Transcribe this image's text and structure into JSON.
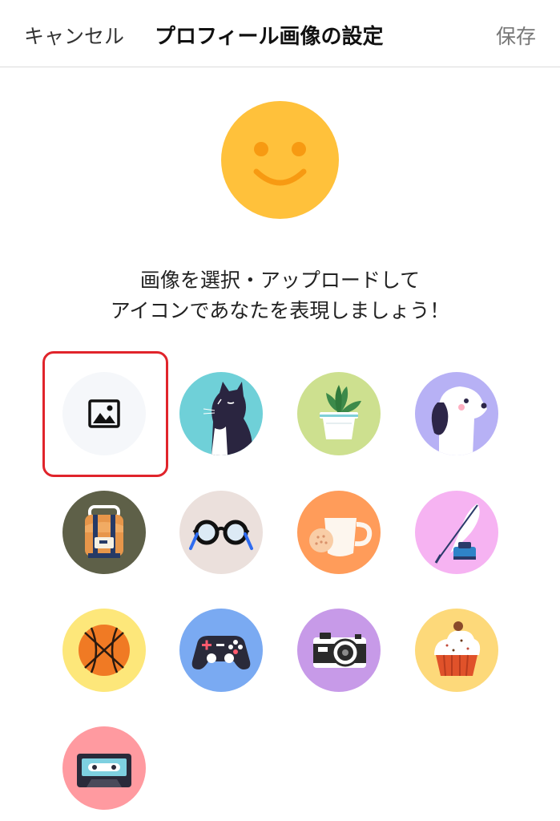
{
  "header": {
    "cancel_label": "キャンセル",
    "title": "プロフィール画像の設定",
    "save_label": "保存"
  },
  "message": {
    "line1": "画像を選択・アップロードして",
    "line2": "アイコンであなたを表現しましょう！"
  },
  "colors": {
    "selection_border": "#e0242b",
    "preview_face": "#ffc13b"
  },
  "icons": [
    "image-upload-icon",
    "cat-icon",
    "plant-icon",
    "dog-icon",
    "backpack-icon",
    "glasses-icon",
    "coffee-cup-icon",
    "quill-ink-icon",
    "basketball-icon",
    "game-controller-icon",
    "camera-icon",
    "cupcake-icon",
    "cassette-tape-icon"
  ]
}
